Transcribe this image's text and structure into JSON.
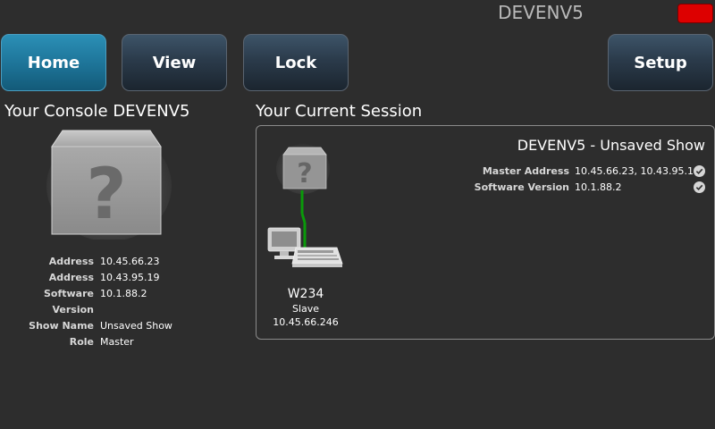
{
  "header": {
    "title": "DEVENV5"
  },
  "nav": {
    "home": "Home",
    "view": "View",
    "lock": "Lock",
    "setup": "Setup"
  },
  "console": {
    "heading": "Your Console DEVENV5",
    "rows": [
      {
        "label": "Address",
        "value": "10.45.66.23"
      },
      {
        "label": "Address",
        "value": "10.43.95.19"
      },
      {
        "label": "Software Version",
        "value": "10.1.88.2"
      },
      {
        "label": "Show Name",
        "value": "Unsaved Show"
      },
      {
        "label": "Role",
        "value": "Master"
      }
    ]
  },
  "session": {
    "heading": "Your Current Session",
    "title": "DEVENV5 - Unsaved Show",
    "master_address_label": "Master Address",
    "master_address_value": "10.45.66.23, 10.43.95.19",
    "software_version_label": "Software Version",
    "software_version_value": "10.1.88.2",
    "node": {
      "name": "W234",
      "role": "Slave",
      "address": "10.45.66.246"
    }
  },
  "colors": {
    "active_button": "#1d7397",
    "status_indicator": "#dd0000",
    "link_line": "#0a9a0a"
  },
  "icons": [
    "unknown-console-icon",
    "check-circle-icon",
    "workstation-icon"
  ]
}
